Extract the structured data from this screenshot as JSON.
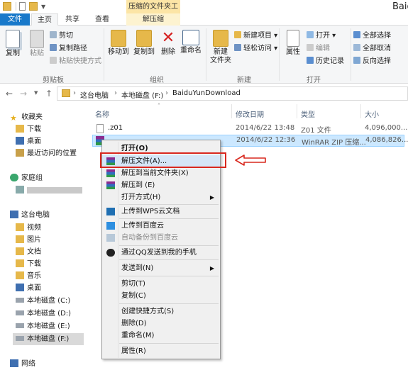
{
  "window": {
    "title": "Baidu",
    "context_tab_title": "压缩的文件夹工具"
  },
  "tabs": [
    {
      "label": "文件"
    },
    {
      "label": "主页"
    },
    {
      "label": "共享"
    },
    {
      "label": "查看"
    },
    {
      "label": "解压缩"
    }
  ],
  "ribbon": {
    "clipboard": {
      "copy": "复制",
      "paste": "粘贴",
      "cut": "剪切",
      "copy_path": "复制路径",
      "paste_shortcut": "粘贴快捷方式",
      "group": "剪贴板"
    },
    "organize": {
      "move_to": "移动到",
      "copy_to": "复制到",
      "delete": "删除",
      "rename": "重命名",
      "group": "组织"
    },
    "new": {
      "new_folder_l1": "新建",
      "new_folder_l2": "文件夹",
      "new_item": "新建项目",
      "easy_access": "轻松访问",
      "group": "新建"
    },
    "open": {
      "properties": "属性",
      "open": "打开",
      "edit": "编辑",
      "history": "历史记录",
      "group": "打开"
    },
    "select": {
      "select_all": "全部选择",
      "select_none": "全部取消",
      "invert": "反向选择"
    }
  },
  "address": {
    "segments": [
      "这台电脑",
      "本地磁盘 (F:)",
      "BaiduYunDownload"
    ]
  },
  "nav": {
    "favorites": "收藏夹",
    "fav_items": [
      "下载",
      "桌面",
      "最近访问的位置"
    ],
    "homegroup": "家庭组",
    "thispc": "这台电脑",
    "pc_items": [
      "视频",
      "图片",
      "文档",
      "下载",
      "音乐",
      "桌面",
      "本地磁盘 (C:)",
      "本地磁盘 (D:)",
      "本地磁盘 (E:)",
      "本地磁盘 (F:)"
    ],
    "network": "网络"
  },
  "columns": {
    "name": "名称",
    "date": "修改日期",
    "type": "类型",
    "size": "大小"
  },
  "files": [
    {
      "name": ".z01",
      "date": "2014/6/22 13:48",
      "type": "Z01 文件",
      "size": "4,096,000..."
    },
    {
      "name": "",
      "date": "2014/6/22 12:36",
      "type": "WinRAR ZIP 压缩...",
      "size": "4,086,826..."
    }
  ],
  "menu": {
    "open": "打开(O)",
    "extract_files": "解压文件(A)...",
    "extract_here": "解压到当前文件夹(X)",
    "extract_to": "解压到 (E)",
    "open_with": "打开方式(H)",
    "wps": "上传到WPS云文档",
    "baidu": "上传到百度云",
    "auto_backup": "自动备份到百度云",
    "qq": "通过QQ发送到我的手机",
    "send_to": "发送到(N)",
    "cut": "剪切(T)",
    "copy": "复制(C)",
    "shortcut": "创建快捷方式(S)",
    "delete": "删除(D)",
    "rename": "重命名(M)",
    "properties": "属性(R)"
  },
  "colors": {
    "accent": "#1979ca",
    "highlight": "#d9281e",
    "selection": "#cce8ff"
  }
}
